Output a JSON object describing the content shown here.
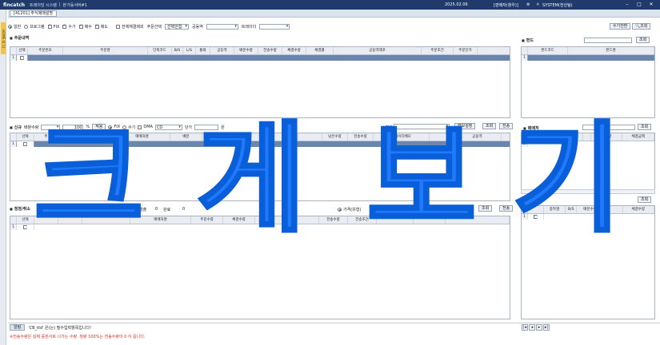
{
  "topbar": {
    "logo": "fincatch",
    "system": "트레이딩 시스템",
    "branch": "본가동서버#1",
    "date": "2025.02.06",
    "user": "[판매자(창우)]",
    "system_user": "SYSTEM(전산팀)"
  },
  "lefttab": {
    "label": "HOME 4[ 1]"
  },
  "window": {
    "tab": "[41201] 주식매매설명"
  },
  "options": {
    "normal": "일반",
    "program": "프로그램",
    "fix": "FIX",
    "manual": "수기",
    "buy": "매수",
    "sell": "매도",
    "all_exec": "전체체결제외",
    "order_select_label": "주문선택",
    "order_select_value": "선택안함",
    "fund_label": "공동역",
    "trader_label": "트레이더",
    "manual_input_btn": "수기전환",
    "query_btn": "조회"
  },
  "order_section": {
    "title": "주문내역",
    "columns": [
      "선택",
      "주문번호",
      "주문명",
      "단축코드",
      "B/S",
      "L/S",
      "통화",
      "공동역",
      "배분수량",
      "전송수량",
      "체결수량",
      "체결률",
      "공동역레포",
      "주문조건",
      "주문단가"
    ]
  },
  "fund_section": {
    "title": "펀드",
    "query_btn": "조회",
    "columns": [
      "펀드코드",
      "펀드명"
    ]
  },
  "new_section": {
    "title": "신규",
    "alloc_label": "배분수량",
    "percent_value": "100",
    "percent_unit": "%",
    "apply_btn": "적용",
    "fix": "FIX",
    "manual": "수기",
    "dma": "DMA",
    "dma_value": "CD",
    "price_label": "단가",
    "won": "원",
    "right_label": "펀드",
    "memo_btn": "메모설정",
    "query_btn": "조회",
    "send_btn": "전송",
    "columns": [
      "선택",
      "주",
      "",
      "매매처명",
      "배분",
      "",
      "",
      "",
      "",
      "남은수량",
      "전송수량",
      "트레이더메모",
      "",
      "공동역"
    ]
  },
  "trader_section": {
    "title": "매매처",
    "query_btn": "조회",
    "columns": [
      "",
      "",
      "",
      "결수량",
      "체결금액"
    ]
  },
  "correct_section": {
    "title": "정정/취소",
    "qty_label": "결출",
    "qty_value": "0",
    "done_label": "완료",
    "done_value": "0",
    "price_type": "가격(유형)",
    "won": "원",
    "query_btn": "조회",
    "send_btn": "전송",
    "columns": [
      "선택",
      "",
      "",
      "",
      "매매처명",
      "주문수량",
      "체결수량",
      "",
      "",
      "전송수량",
      "전송조건",
      "",
      "",
      ""
    ]
  },
  "exec_section": {
    "columns": [
      "",
      "종목명",
      "B/S",
      "배분수량",
      "",
      "체결수량"
    ]
  },
  "watermark": [
    "크",
    "게",
    "보",
    "기"
  ],
  "status": {
    "label": "알림",
    "message": "'CB_ttd' 은(는) 필수입력항목입니다!",
    "warning": "※전송수량은 실제 증권사로 나가는 수량. 정량 100%는 전송수량이 0 이 됩니다."
  },
  "colors": {
    "accent": "#1f3a6b",
    "row_selected": "#6b86ad",
    "watermark": "#1e7bff",
    "warning": "#d9302b"
  }
}
